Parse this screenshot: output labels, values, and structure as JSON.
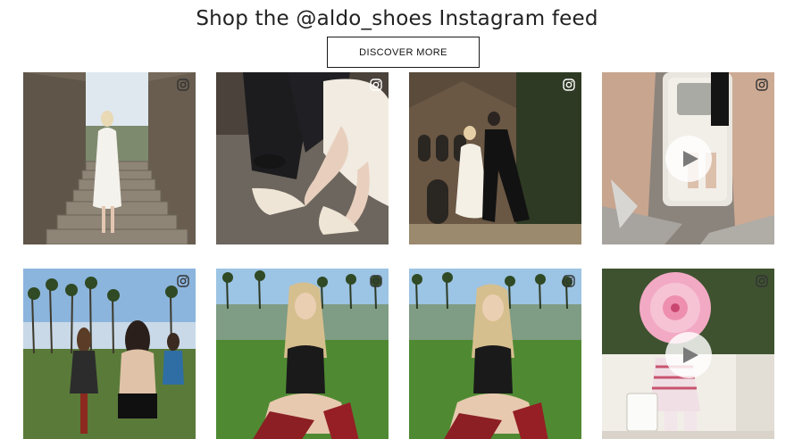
{
  "header": {
    "title": "Shop the @aldo_shoes Instagram feed",
    "discover_label": "DISCOVER MORE"
  },
  "feed": {
    "posts": [
      {
        "media": "image",
        "icon": "instagram-icon"
      },
      {
        "media": "image",
        "icon": "instagram-icon"
      },
      {
        "media": "image",
        "icon": "instagram-icon"
      },
      {
        "media": "video",
        "icon": "instagram-icon"
      },
      {
        "media": "image",
        "icon": "instagram-icon"
      },
      {
        "media": "image",
        "icon": "instagram-icon"
      },
      {
        "media": "image",
        "icon": "instagram-icon"
      },
      {
        "media": "video",
        "icon": "instagram-icon"
      }
    ]
  },
  "colors": {
    "text": "#222222",
    "button_border": "#1a1a1a",
    "play_overlay": "#ffffff"
  }
}
